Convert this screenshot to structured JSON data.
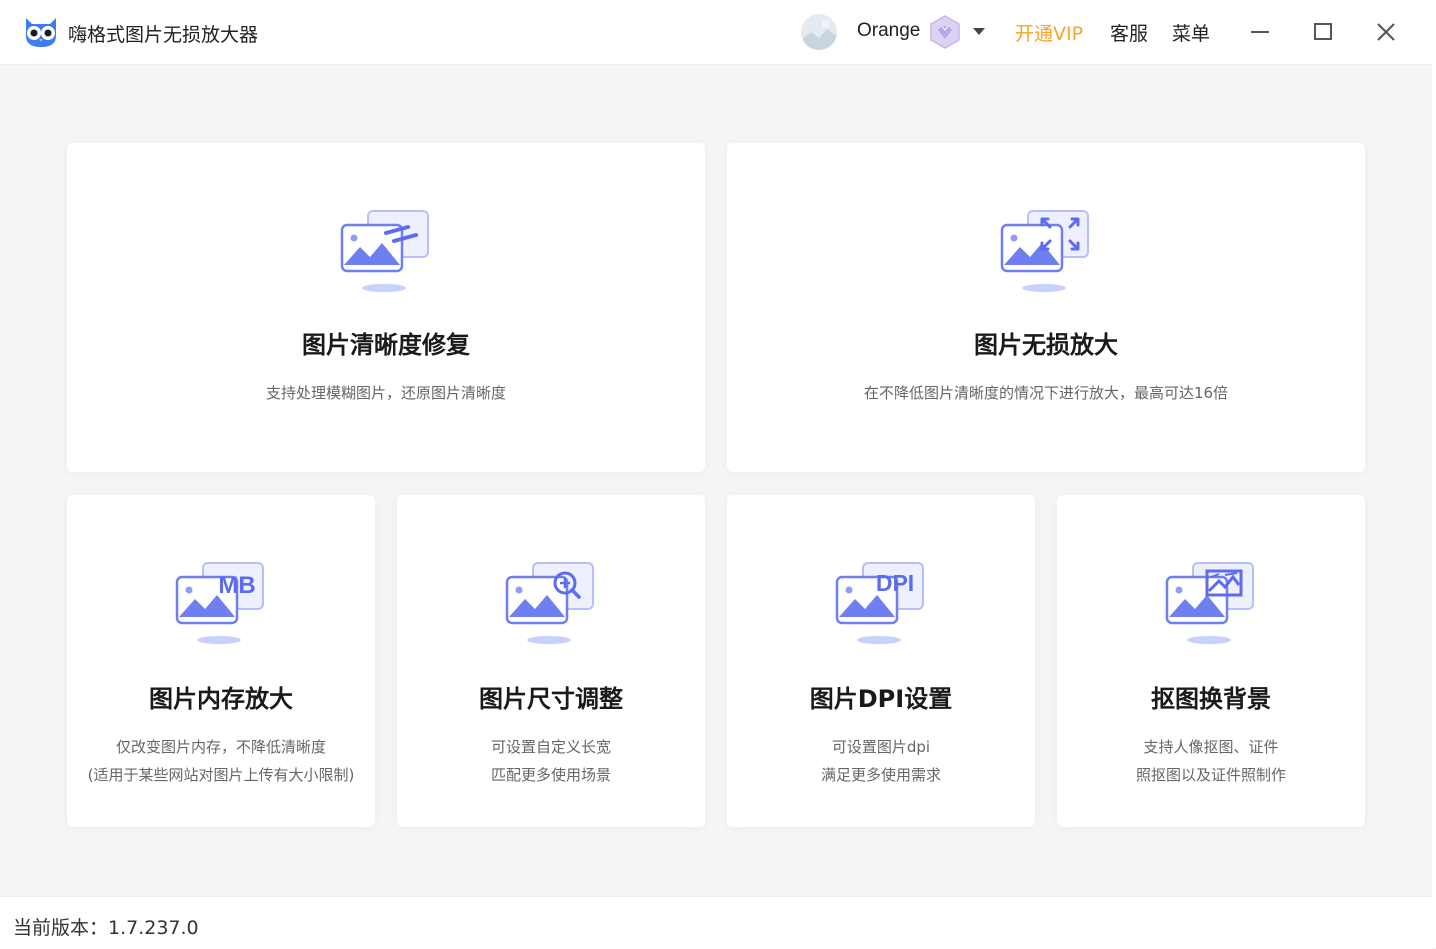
{
  "app": {
    "title": "嗨格式图片无损放大器",
    "accent_color": "#f5a623",
    "brand_color": "#5b6cf0"
  },
  "header": {
    "username": "Orange",
    "vip_label": "开通VIP",
    "service_label": "客服",
    "menu_label": "菜单"
  },
  "features": [
    {
      "title": "图片清晰度修复",
      "desc": [
        "支持处理模糊图片，还原图片清晰度"
      ],
      "icon": "image-sharpen-icon"
    },
    {
      "title": "图片无损放大",
      "desc": [
        "在不降低图片清晰度的情况下进行放大，最高可达16倍"
      ],
      "icon": "image-expand-icon"
    },
    {
      "title": "图片内存放大",
      "desc": [
        "仅改变图片内存，不降低清晰度",
        "(适用于某些网站对图片上传有大小限制)"
      ],
      "icon": "image-mb-icon",
      "badge": "MB"
    },
    {
      "title": "图片尺寸调整",
      "desc": [
        "可设置自定义长宽",
        "匹配更多使用场景"
      ],
      "icon": "image-zoom-icon"
    },
    {
      "title": "图片DPI设置",
      "desc": [
        "可设置图片dpi",
        "满足更多使用需求"
      ],
      "icon": "image-dpi-icon",
      "badge": "DPI"
    },
    {
      "title": "抠图换背景",
      "desc": [
        "支持人像抠图、证件",
        "照抠图以及证件照制作"
      ],
      "icon": "image-cutout-icon"
    }
  ],
  "footer": {
    "version_label": "当前版本：1.7.237.0"
  }
}
